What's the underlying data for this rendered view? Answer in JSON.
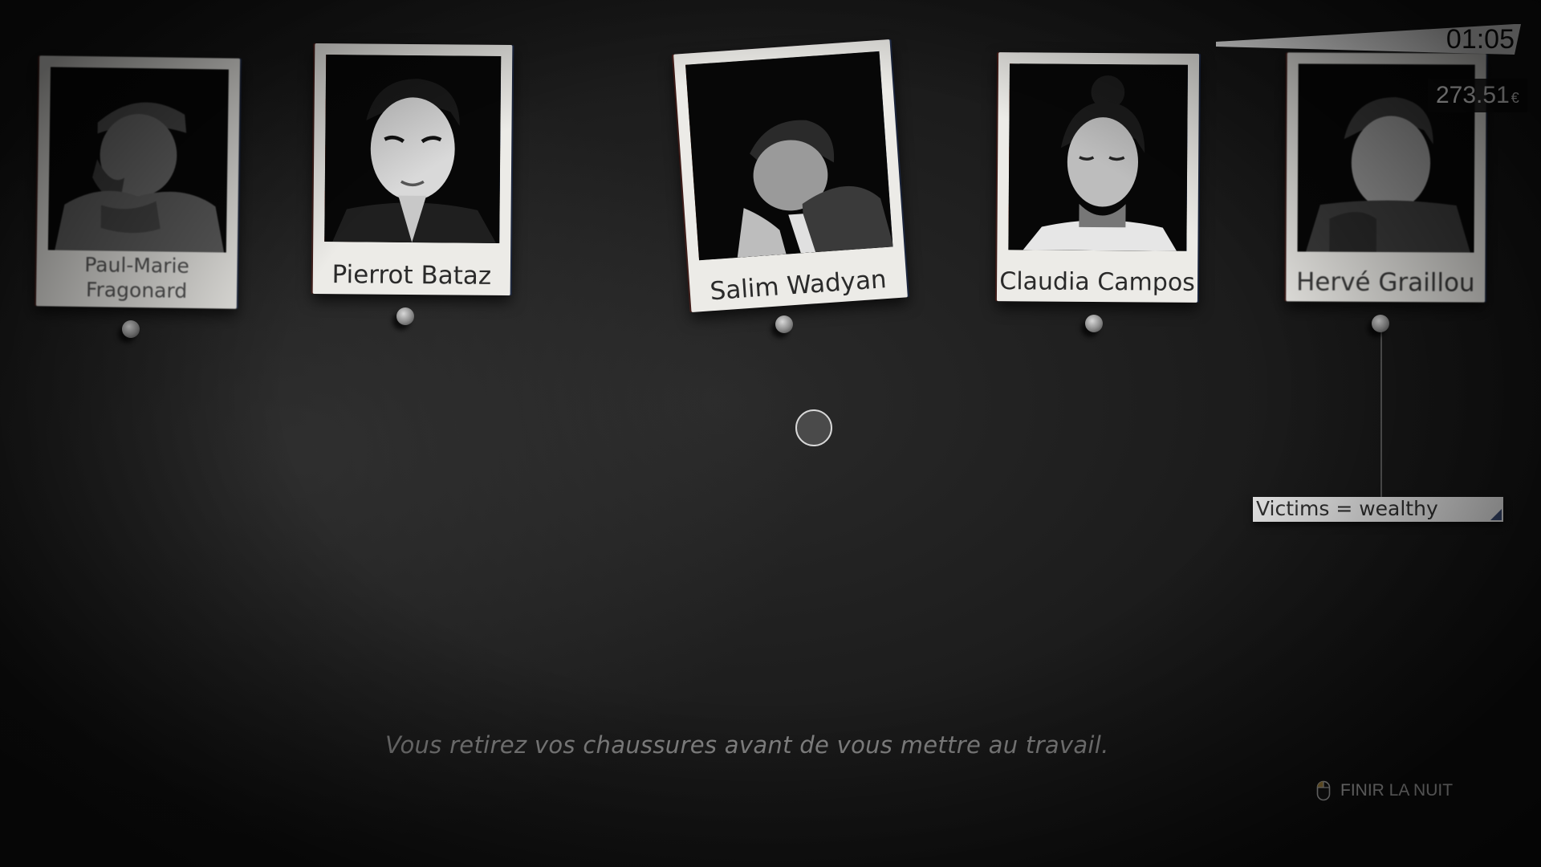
{
  "hud": {
    "timer": "01:05",
    "money_value": "273.51",
    "money_currency": "€"
  },
  "suspects": [
    {
      "name": "Paul-Marie Fragonard",
      "portrait_icon": "man-with-flat-cap-portrait"
    },
    {
      "name": "Pierrot Bataz",
      "portrait_icon": "young-man-portrait"
    },
    {
      "name": "Salim Wadyan",
      "portrait_icon": "man-resting-head-portrait"
    },
    {
      "name": "Claudia Campos",
      "portrait_icon": "woman-with-bun-portrait"
    },
    {
      "name": "Hervé Graillou",
      "portrait_icon": "man-in-jacket-portrait"
    }
  ],
  "notes": [
    {
      "text": "Victims = wealthy"
    }
  ],
  "narration": "Vous retirez vos chaussures avant de vous mettre au travail.",
  "actions": {
    "finish_label": "FINIR LA NUIT",
    "finish_icon": "mouse-left-click-icon"
  },
  "colors": {
    "background": "#1c1c1c",
    "card": "#ecebe7",
    "timer_bar": "#f2f2f2",
    "accent_mouse": "#c9a24a"
  }
}
